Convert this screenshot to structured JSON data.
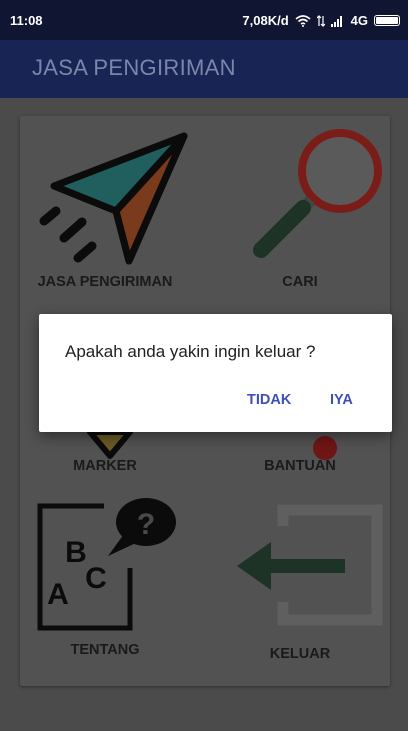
{
  "statusbar": {
    "time": "11:08",
    "speed": "7,08K/d",
    "network": "4G"
  },
  "appbar": {
    "title": "JASA PENGIRIMAN"
  },
  "menu": {
    "items": [
      {
        "label": "JASA PENGIRIMAN",
        "icon": "paper-plane-icon"
      },
      {
        "label": "CARI",
        "icon": "magnifier-icon"
      },
      {
        "label": "MARKER",
        "icon": "map-marker-icon"
      },
      {
        "label": "BANTUAN",
        "icon": "help-pin-icon"
      },
      {
        "label": "TENTANG",
        "icon": "abc-speech-icon"
      },
      {
        "label": "KELUAR",
        "icon": "exit-arrow-icon"
      }
    ]
  },
  "dialog": {
    "message": "Apakah anda yakin ingin keluar ?",
    "cancel_label": "TIDAK",
    "confirm_label": "IYA"
  },
  "colors": {
    "appbar": "#182454",
    "statusbar": "#101632",
    "dialog_button": "#3f51b5",
    "dim": "#4b4b4b"
  }
}
